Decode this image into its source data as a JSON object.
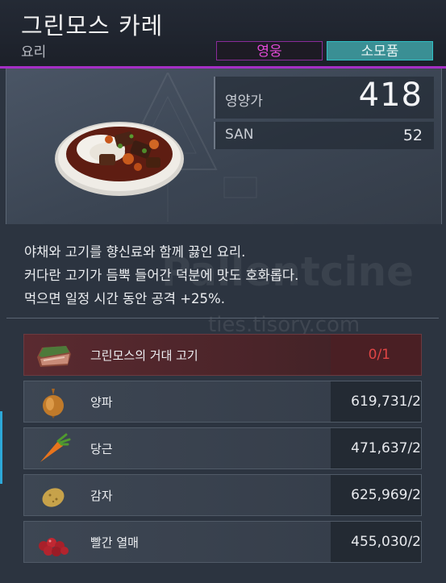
{
  "item": {
    "name": "그린모스 카레",
    "category": "요리",
    "tags": {
      "hero": "영웅",
      "consumable": "소모품"
    }
  },
  "stats": {
    "nutrition_label": "영양가",
    "nutrition_value": "418",
    "san_label": "SAN",
    "san_value": "52"
  },
  "description": [
    "야채와 고기를 향신료와 함께 끓인 요리.",
    "커다란 고기가 듬뿍 들어간 덕분에 맛도 호화롭다.",
    "먹으면 일정 시간 동안 공격 +25%."
  ],
  "watermark": {
    "text": "Pallentcine",
    "url": "ties.tisory.com"
  },
  "ingredients": [
    {
      "name": "그린모스의 거대 고기",
      "qty": "0/1",
      "icon": "meat-icon",
      "missing": true
    },
    {
      "name": "양파",
      "qty": "619,731/2",
      "icon": "onion-icon",
      "missing": false
    },
    {
      "name": "당근",
      "qty": "471,637/2",
      "icon": "carrot-icon",
      "missing": false
    },
    {
      "name": "감자",
      "qty": "625,969/2",
      "icon": "potato-icon",
      "missing": false
    },
    {
      "name": "빨간 열매",
      "qty": "455,030/2",
      "icon": "red-berries-icon",
      "missing": false
    }
  ],
  "colors": {
    "rarity_accent": "#a52fc6",
    "consumable_tag": "#3a8f94",
    "missing_qty": "#e04545"
  }
}
